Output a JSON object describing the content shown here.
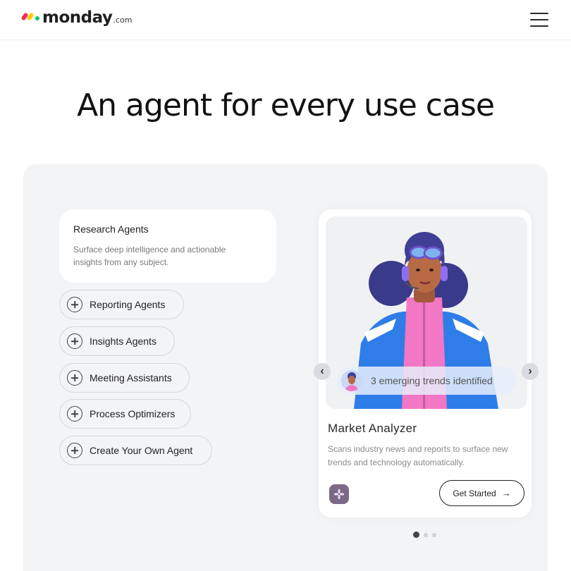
{
  "header": {
    "logo_word": "monday",
    "logo_tld": ".com",
    "menu_icon": "hamburger-menu-icon"
  },
  "hero": {
    "title": "An agent for every use case"
  },
  "agents_menu": {
    "active": {
      "title": "Research Agents",
      "description": "Surface deep intelligence and actionable insights from any subject."
    },
    "items": [
      {
        "label": "Reporting Agents",
        "icon": "plus-circle-icon"
      },
      {
        "label": "Insights Agents",
        "icon": "plus-circle-icon"
      },
      {
        "label": "Meeting Assistants",
        "icon": "plus-circle-icon"
      },
      {
        "label": "Process Optimizers",
        "icon": "plus-circle-icon"
      },
      {
        "label": "Create Your Own Agent",
        "icon": "plus-circle-icon"
      }
    ]
  },
  "carousel": {
    "trend_text": "3 emerging trends identified",
    "agent_name": "Market Analyzer",
    "agent_description": "Scans industry news and reports to surface new trends and technology automatically.",
    "cta_label": "Get Started",
    "cta_arrow": "→",
    "prev_glyph": "‹",
    "next_glyph": "›",
    "integration_icon": "slack-icon",
    "slide_count": 3,
    "active_slide": 1
  },
  "colors": {
    "panel_bg": "#f3f4f6",
    "brand_red": "#f62b54",
    "brand_yellow": "#ffcc00",
    "brand_green": "#00ca72"
  }
}
